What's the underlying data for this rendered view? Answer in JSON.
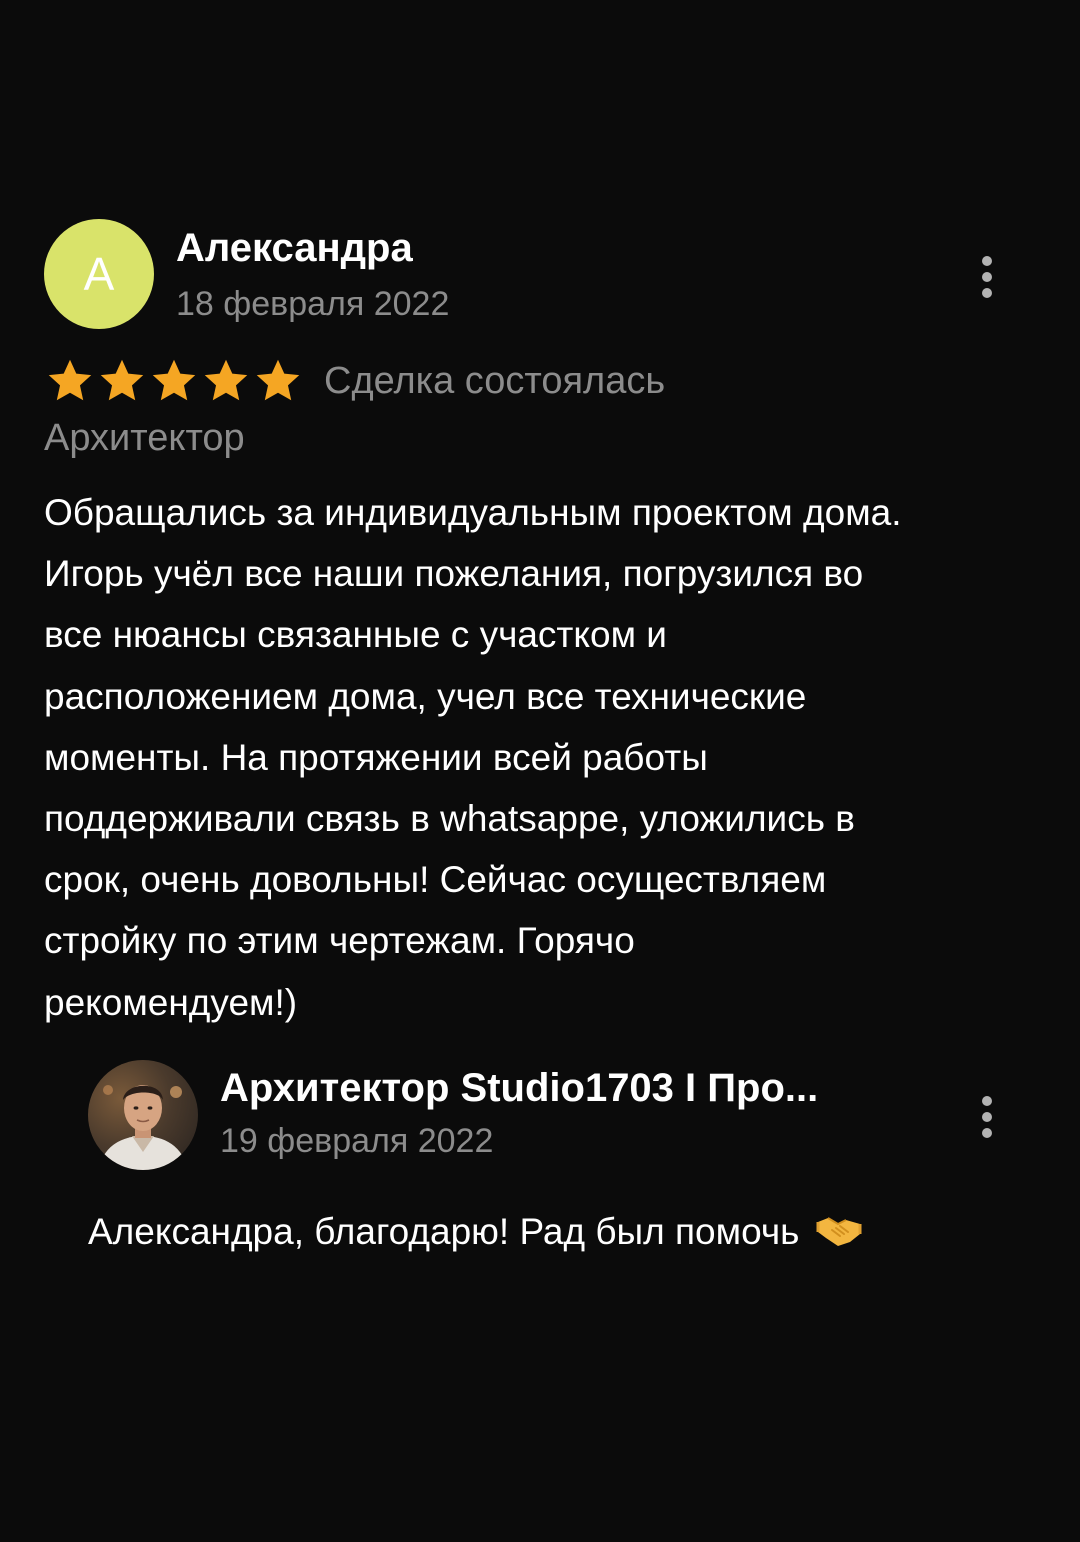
{
  "review": {
    "avatar_letter": "А",
    "author": "Александра",
    "date": "18 февраля 2022",
    "rating": 5,
    "rating_max": 5,
    "deal_status": "Сделка состоялась",
    "service": "Архитектор",
    "text_lines": [
      "Обращались за индивидуальным проектом дома.",
      "Игорь учёл все наши пожелания, погрузился во",
      "все нюансы связанные с участком и",
      "расположением дома, учел все технические",
      "моменты. На протяжении всей работы",
      "поддерживали связь в whatsappe, уложились в",
      "срок, очень довольны! Сейчас осуществляем",
      "стройку по этим чертежам. Горячо",
      "рекомендуем!)"
    ],
    "more_icon": "more-vertical-icon"
  },
  "reply": {
    "author": "Архитектор Studio1703 I Про...",
    "date": "19 февраля 2022",
    "text": "Александра, благодарю! Рад был помочь",
    "text_icon": "handshake-icon",
    "more_icon": "more-vertical-icon"
  },
  "colors": {
    "background": "#0b0b0b",
    "avatar": "#d9e36a",
    "star": "#f5a623",
    "muted_text": "#8c8c8c",
    "primary_text": "#ffffff"
  }
}
